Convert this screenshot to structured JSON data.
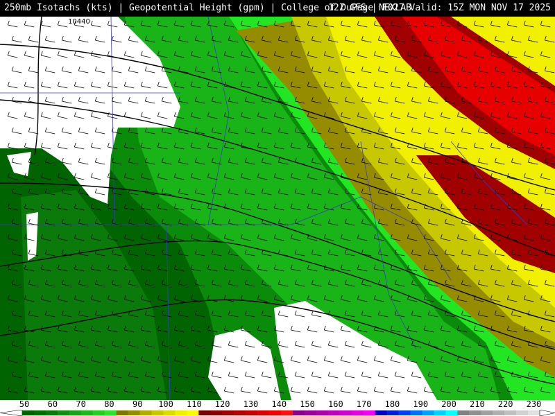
{
  "header": {
    "left_title": "250mb Isotachs (kts) | Geopotential Height (gpm) | College of DuPage NEXLAB",
    "right_title": "12Z GFS | F027 Valid: 15Z MON NOV 17 2025"
  },
  "map": {
    "contour_label": "10440",
    "colors": {
      "calm": "#ffffff",
      "green_dark": "#006400",
      "green_mid": "#0a8c0a",
      "green_light": "#18b418",
      "green_bright": "#22e622",
      "olive": "#968c00",
      "yellow_dark": "#c8c800",
      "yellow": "#f0f000",
      "red_dark": "#a00000",
      "red": "#e60000"
    }
  },
  "legend": {
    "ticks": [
      "50",
      "60",
      "70",
      "80",
      "90",
      "100",
      "110",
      "120",
      "130",
      "140",
      "150",
      "160",
      "170",
      "180",
      "190",
      "200",
      "210",
      "220",
      "230"
    ],
    "colors": [
      "#006400",
      "#007000",
      "#087c08",
      "#109010",
      "#18a418",
      "#1cb81c",
      "#22d022",
      "#2ae62a",
      "#7c7800",
      "#968c00",
      "#b4aa00",
      "#c8c800",
      "#dcdc00",
      "#f0f000",
      "#fafa00",
      "#780000",
      "#8c0000",
      "#a00000",
      "#b40000",
      "#c80000",
      "#dc0000",
      "#f00000",
      "#ff1010",
      "#880088",
      "#9a009a",
      "#ac00ac",
      "#be00be",
      "#d000d0",
      "#e200e2",
      "#f400f4",
      "#0000c0",
      "#0020d8",
      "#0040f0",
      "#0070f8",
      "#00a0ff",
      "#00d0ff",
      "#00ffff",
      "#808080",
      "#909090",
      "#a0a0a0",
      "#b0b0b0",
      "#c0c0c0",
      "#d0d0d0",
      "#e0e0e0"
    ]
  }
}
